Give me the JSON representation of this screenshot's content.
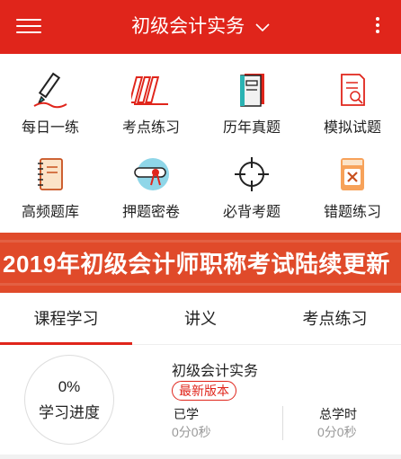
{
  "header": {
    "title": "初级会计实务",
    "colors": {
      "bar": "#e0251b",
      "text": "#ffffff"
    },
    "icons": {
      "left": "menu-icon",
      "title_dropdown": "chevron-down-icon",
      "right": "more-vertical-icon"
    }
  },
  "grid": {
    "items": [
      {
        "label": "每日一练",
        "icon": "pen-writing-icon"
      },
      {
        "label": "考点练习",
        "icon": "books-icon"
      },
      {
        "label": "历年真题",
        "icon": "notebook-icon"
      },
      {
        "label": "模拟试题",
        "icon": "document-search-icon"
      },
      {
        "label": "高频题库",
        "icon": "spiral-notebook-icon"
      },
      {
        "label": "押题密卷",
        "icon": "scroll-ribbon-icon"
      },
      {
        "label": "必背考题",
        "icon": "target-crosshair-icon"
      },
      {
        "label": "错题练习",
        "icon": "error-book-icon"
      }
    ]
  },
  "banner": {
    "text": "2019年初级会计师职称考试陆续更新"
  },
  "tabs": [
    {
      "label": "课程学习",
      "active": true
    },
    {
      "label": "讲义",
      "active": false
    },
    {
      "label": "考点练习",
      "active": false
    }
  ],
  "course": {
    "progress_percent": "0%",
    "progress_label": "学习进度",
    "title": "初级会计实务",
    "badge": "最新版本",
    "studied_label": "已学",
    "studied_value": "0分0秒",
    "total_label": "总学时",
    "total_value": "0分0秒"
  }
}
